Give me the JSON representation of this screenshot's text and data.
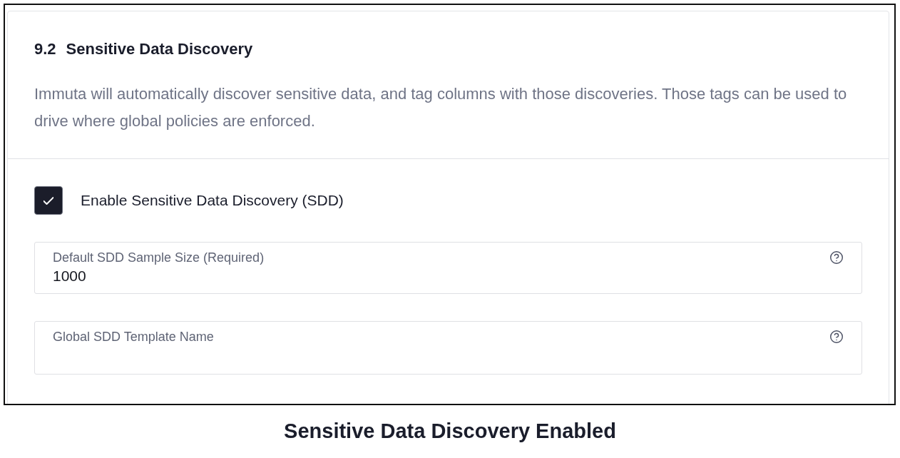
{
  "section": {
    "number": "9.2",
    "title": "Sensitive Data Discovery",
    "description": "Immuta will automatically discover sensitive data, and tag columns with those discoveries. Those tags can be used to drive where global policies are enforced."
  },
  "enable_checkbox": {
    "label": "Enable Sensitive Data Discovery (SDD)",
    "checked": true
  },
  "fields": [
    {
      "label": "Default SDD Sample Size (Required)",
      "value": "1000"
    },
    {
      "label": "Global SDD Template Name"
    }
  ],
  "caption": "Sensitive Data Discovery Enabled"
}
